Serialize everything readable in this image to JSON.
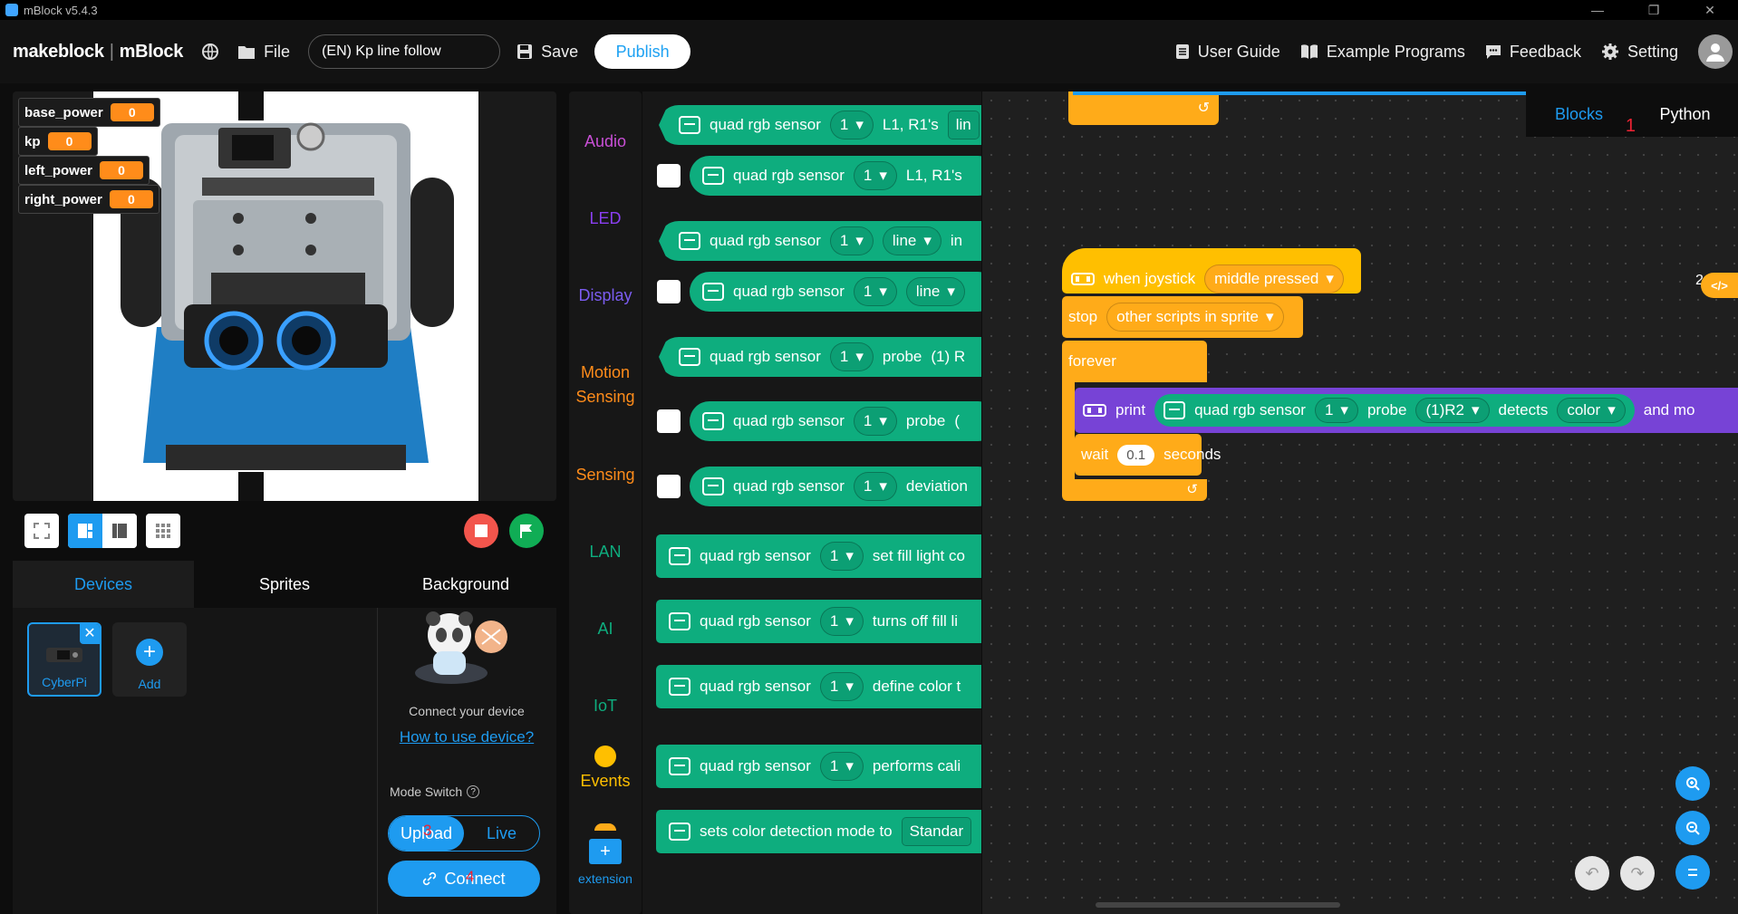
{
  "window": {
    "title": "mBlock v5.4.3",
    "controls": [
      "—",
      "❐",
      "✕"
    ]
  },
  "menubar": {
    "logo_brand": "makeblock",
    "logo_product": "mBlock",
    "file_label": "File",
    "project_name": "(EN) Kp line follow",
    "save_label": "Save",
    "publish_label": "Publish",
    "user_guide_label": "User Guide",
    "example_programs_label": "Example Programs",
    "feedback_label": "Feedback",
    "setting_label": "Setting"
  },
  "stage": {
    "variables": [
      {
        "name": "base_power",
        "value": "0"
      },
      {
        "name": "kp",
        "value": "0"
      },
      {
        "name": "left_power",
        "value": "0"
      },
      {
        "name": "right_power",
        "value": "0"
      }
    ]
  },
  "device_panel": {
    "tabs": [
      "Devices",
      "Sprites",
      "Background"
    ],
    "active_tab": "Devices",
    "device_name": "CyberPi",
    "add_label": "Add",
    "connect_text": "Connect your device",
    "how_to_link": "How to use device?",
    "mode_switch_label": "Mode Switch",
    "mode_upload": "Upload",
    "mode_live": "Live",
    "connect_button": "Connect"
  },
  "categories": [
    {
      "label": "Audio",
      "color": "#c94fd6"
    },
    {
      "label": "LED",
      "color": "#8a3ff2"
    },
    {
      "label": "Display",
      "color": "#7b5cf0"
    },
    {
      "label": "Motion",
      "color": "#ff8c1a"
    },
    {
      "label": "Sensing",
      "color": "#ff8c1a"
    },
    {
      "label": "Sensing",
      "color": "#ff8c1a"
    },
    {
      "label": "LAN",
      "color": "#0ead7e"
    },
    {
      "label": "AI",
      "color": "#0ead7e"
    },
    {
      "label": "IoT",
      "color": "#0ead7e"
    },
    {
      "label": "Events",
      "color": "#ffbf00"
    }
  ],
  "extension_label": "extension",
  "palette": {
    "sensor_name": "quad rgb sensor",
    "port": "1",
    "blocks": [
      {
        "type": "rep-left",
        "parts": [
          "L1, R1's",
          "lin"
        ]
      },
      {
        "type": "rep-check",
        "parts": [
          "L1, R1's"
        ]
      },
      {
        "type": "rep-left",
        "parts": [
          "line",
          "in"
        ]
      },
      {
        "type": "rep-check",
        "parts": [
          "line"
        ]
      },
      {
        "type": "rep-left",
        "parts": [
          "probe",
          "(1) R"
        ]
      },
      {
        "type": "rep-check",
        "parts": [
          "probe",
          "("
        ]
      },
      {
        "type": "rep-check",
        "parts": [
          "deviation"
        ]
      },
      {
        "type": "cmd",
        "parts": [
          "set fill light co"
        ]
      },
      {
        "type": "cmd",
        "parts": [
          "turns off fill li"
        ]
      },
      {
        "type": "cmd",
        "parts": [
          "define color t"
        ]
      },
      {
        "type": "cmd",
        "parts": [
          "performs cali"
        ]
      }
    ],
    "last_block": {
      "text": "sets color detection mode to",
      "value": "Standar"
    }
  },
  "script": {
    "when_joystick": "when joystick",
    "joystick_option": "middle pressed",
    "stop_label": "stop",
    "stop_option": "other scripts in sprite",
    "forever_label": "forever",
    "print_label": "print",
    "sensor_name": "quad rgb sensor",
    "port": "1",
    "probe_label": "probe",
    "probe_value": "(1)R2",
    "detects_label": "detects",
    "detects_value": "color",
    "and_more": "and mo",
    "wait_label": "wait",
    "wait_value": "0.1",
    "seconds_label": "seconds"
  },
  "view_tabs": {
    "blocks": "Blocks",
    "python": "Python",
    "annotation_1": "1",
    "annotation_2": "2",
    "annotation_3": "3",
    "annotation_4": "4"
  },
  "colors": {
    "accent": "#1e9bf0",
    "sensor_green": "#0ead7e",
    "control_orange": "#ffab19",
    "event_yellow": "#ffbf00",
    "print_purple": "#7743d6",
    "variable_orange": "#ff8c1a"
  }
}
